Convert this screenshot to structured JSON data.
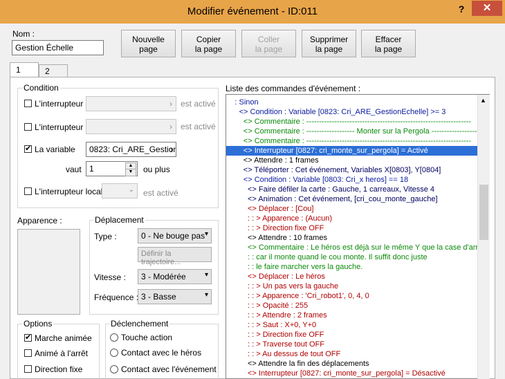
{
  "window": {
    "title": "Modifier événement - ID:011",
    "help": "?",
    "close": "✕"
  },
  "name": {
    "label": "Nom :",
    "value": "Gestion Échelle"
  },
  "toolbar": {
    "new_page": [
      "Nouvelle",
      "page"
    ],
    "copy_page": [
      "Copier",
      "la page"
    ],
    "paste_page": [
      "Coller",
      "la page"
    ],
    "delete_page": [
      "Supprimer",
      "la page"
    ],
    "clear_page": [
      "Effacer",
      "la page"
    ]
  },
  "tabs": [
    "1",
    "2"
  ],
  "condition": {
    "label": "Condition",
    "switch1": {
      "label": "L'interrupteur",
      "checked": false,
      "suffix": "est activé"
    },
    "switch2": {
      "label": "L'interrupteur",
      "checked": false,
      "suffix": "est activé"
    },
    "variable": {
      "label": "La variable",
      "checked": true,
      "value": "0823: Cri_ARE_Gestion"
    },
    "vaut": {
      "label": "vaut",
      "value": "1",
      "suffix": "ou plus"
    },
    "local_switch": {
      "label": "L'interrupteur local",
      "checked": false,
      "suffix": "est activé"
    }
  },
  "appearance": {
    "label": "Apparence :"
  },
  "movement": {
    "label": "Déplacement",
    "type_label": "Type :",
    "type_value": "0 - Ne bouge pas",
    "route_button": "Définir la trajectoire...",
    "speed_label": "Vitesse :",
    "speed_value": "3 - Modérée",
    "freq_label": "Fréquence :",
    "freq_value": "3 - Basse"
  },
  "options": {
    "label": "Options",
    "items": [
      {
        "label": "Marche animée",
        "checked": true
      },
      {
        "label": "Animé à l'arrêt",
        "checked": false
      },
      {
        "label": "Direction fixe",
        "checked": false
      }
    ]
  },
  "trigger": {
    "label": "Déclenchement",
    "items": [
      {
        "label": "Touche action"
      },
      {
        "label": "Contact avec le héros"
      },
      {
        "label": "Contact avec l'événement"
      }
    ]
  },
  "commands": {
    "label": "Liste des commandes d'événement :",
    "lines": [
      {
        "text": ": Sinon",
        "indent": 2,
        "color": "blue"
      },
      {
        "text": "<> Condition : Variable [0823: Cri_ARE_GestionEchelle] >= 3",
        "indent": 3,
        "color": "blue"
      },
      {
        "text": "<> Commentaire : -----------------------------------------------------------------",
        "indent": 4,
        "color": "green"
      },
      {
        "text": "<> Commentaire : ------------------- Monter sur la Pergola ------------------",
        "indent": 4,
        "color": "green"
      },
      {
        "text": "<> Commentaire : -----------------------------------------------------------------",
        "indent": 4,
        "color": "green"
      },
      {
        "text": "<> Interrupteur [0827: cri_monte_sur_pergola] = Activé",
        "indent": 4,
        "color": "red",
        "selected": true
      },
      {
        "text": "<> Attendre : 1 frames",
        "indent": 4,
        "color": "black"
      },
      {
        "text": "<> Téléporter : Cet événement, Variables X[0803], Y[0804]",
        "indent": 4,
        "color": "navy"
      },
      {
        "text": "<> Condition : Variable [0803: Cri_x heros] == 18",
        "indent": 4,
        "color": "blue"
      },
      {
        "text": "<> Faire défiler la carte : Gauche, 1 carreaux, Vitesse 4",
        "indent": 5,
        "color": "navy"
      },
      {
        "text": "<> Animation : Cet événement, [cri_cou_monte_gauche]",
        "indent": 5,
        "color": "navy"
      },
      {
        "text": "<> Déplacer : [Cou]",
        "indent": 5,
        "color": "red"
      },
      {
        "text": ":                    : > Apparence : (Aucun)",
        "indent": 5,
        "color": "red"
      },
      {
        "text": ":                    : > Direction fixe OFF",
        "indent": 5,
        "color": "red"
      },
      {
        "text": "<> Attendre : 10 frames",
        "indent": 5,
        "color": "black"
      },
      {
        "text": "<> Commentaire : Le héros est déjà sur le même Y que la case d'arriv",
        "indent": 5,
        "color": "green"
      },
      {
        "text": ":                              : car il monte quand le cou monte. Il suffit donc juste",
        "indent": 5,
        "color": "green"
      },
      {
        "text": ":                              : le faire marcher vers la gauche.",
        "indent": 5,
        "color": "green"
      },
      {
        "text": "<> Déplacer : Le héros",
        "indent": 5,
        "color": "red"
      },
      {
        "text": ":                    : > Un pas vers la gauche",
        "indent": 5,
        "color": "red"
      },
      {
        "text": ":                    : > Apparence : 'Cri_robot1', 0, 4, 0",
        "indent": 5,
        "color": "red"
      },
      {
        "text": ":                    : > Opacité : 255",
        "indent": 5,
        "color": "red"
      },
      {
        "text": ":                    : > Attendre : 2 frames",
        "indent": 5,
        "color": "red"
      },
      {
        "text": ":                    : > Saut : X+0, Y+0",
        "indent": 5,
        "color": "red"
      },
      {
        "text": ":                    : > Direction fixe OFF",
        "indent": 5,
        "color": "red"
      },
      {
        "text": ":                    : > Traverse tout OFF",
        "indent": 5,
        "color": "red"
      },
      {
        "text": ":                    : > Au dessus de tout OFF",
        "indent": 5,
        "color": "red"
      },
      {
        "text": "<> Attendre la fin des déplacements",
        "indent": 5,
        "color": "black"
      },
      {
        "text": "<> Interrupteur [0827: cri_monte_sur_pergola] = Désactivé",
        "indent": 5,
        "color": "red"
      }
    ]
  },
  "scroll": {
    "up": "▲",
    "thumb_position": 0.36
  }
}
